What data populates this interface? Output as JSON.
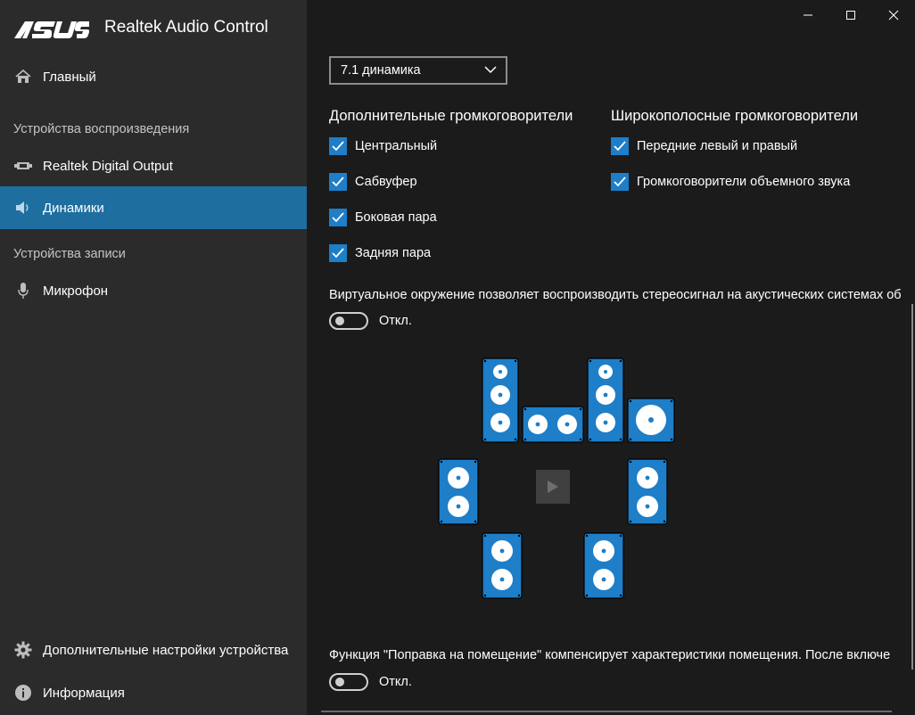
{
  "app": {
    "brand": "ASUS",
    "title": "Realtek Audio Control"
  },
  "window_controls": {
    "minimize": "minimize-icon",
    "maximize": "maximize-icon",
    "close": "close-icon"
  },
  "sidebar": {
    "home": {
      "label": "Главный",
      "icon": "home-icon"
    },
    "playback_section": "Устройства воспроизведения",
    "playback_items": [
      {
        "label": "Realtek Digital Output",
        "icon": "digital-output-icon"
      },
      {
        "label": "Динамики",
        "icon": "speaker-icon",
        "active": true
      }
    ],
    "record_section": "Устройства записи",
    "record_items": [
      {
        "label": "Микрофон",
        "icon": "microphone-icon"
      }
    ],
    "bottom_items": [
      {
        "label": "Дополнительные настройки устройства",
        "icon": "gear-icon"
      },
      {
        "label": "Информация",
        "icon": "info-icon"
      }
    ]
  },
  "main": {
    "config_select": {
      "value": "7.1 динамика"
    },
    "optional_speakers": {
      "title": "Дополнительные громкоговорители",
      "items": [
        {
          "label": "Центральный",
          "checked": true
        },
        {
          "label": "Сабвуфер",
          "checked": true
        },
        {
          "label": "Боковая пара",
          "checked": true
        },
        {
          "label": "Задняя пара",
          "checked": true
        }
      ]
    },
    "fullrange_speakers": {
      "title": "Широкополосные громкоговорители",
      "items": [
        {
          "label": "Передние левый и правый",
          "checked": true
        },
        {
          "label": "Громкоговорители объемного звука",
          "checked": true
        }
      ]
    },
    "virtual_surround": {
      "description": "Виртуальное окружение позволяет воспроизводить стереосигнал на акустических системах об",
      "toggle_label": "Откл.",
      "on": false
    },
    "room_correction": {
      "description": "Функция \"Поправка на помещение\" компенсирует характеристики помещения. После включе",
      "toggle_label": "Откл.",
      "on": false
    },
    "test_button": {
      "icon": "play-icon"
    },
    "colors": {
      "accent": "#1e6fa0",
      "speaker_blue": "#1e7ec8",
      "checkbox": "#1e7ec8",
      "background": "#1b1b1b",
      "sidebar": "#2b2b2b"
    }
  }
}
